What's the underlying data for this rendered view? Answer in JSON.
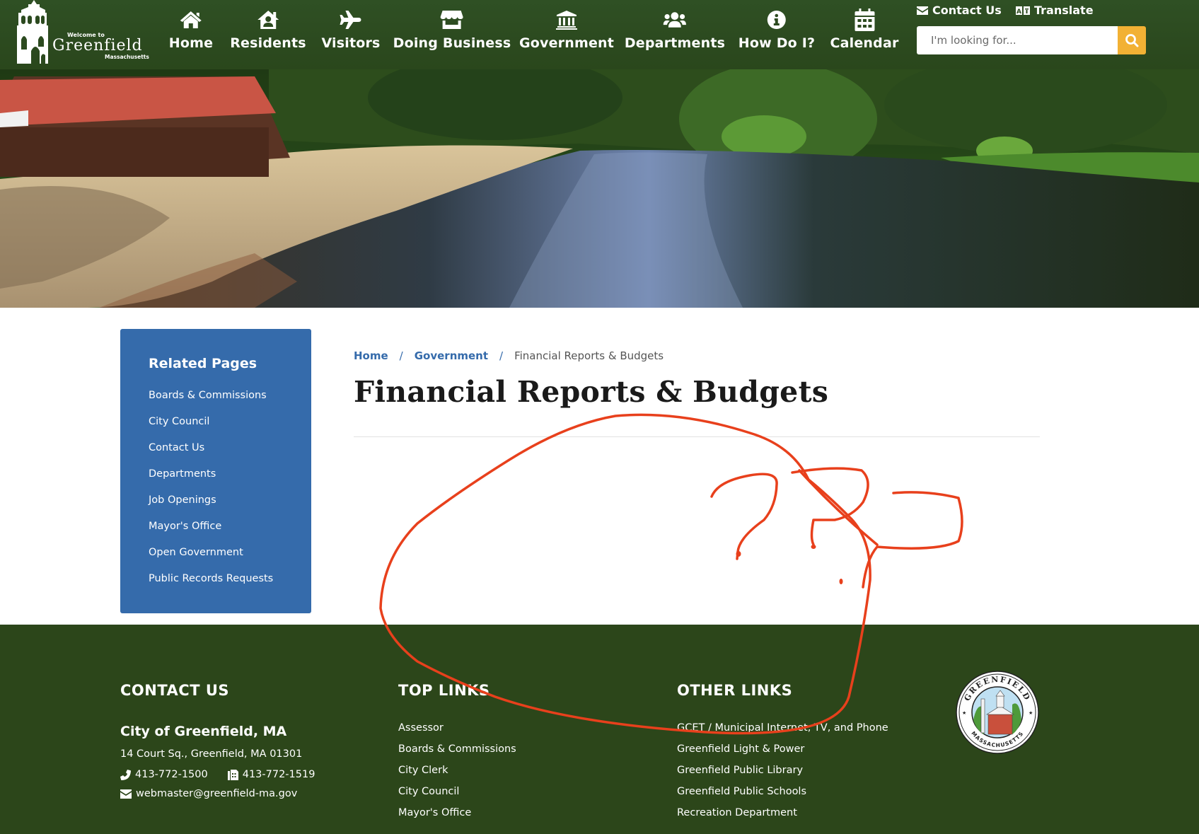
{
  "header": {
    "logo": {
      "welcome": "Welcome to",
      "name": "Greenfield",
      "state": "Massachusetts"
    },
    "nav": [
      {
        "label": "Home",
        "icon": "home-icon"
      },
      {
        "label": "Residents",
        "icon": "house-user-icon"
      },
      {
        "label": "Visitors",
        "icon": "plane-icon"
      },
      {
        "label": "Doing Business",
        "icon": "store-icon"
      },
      {
        "label": "Government",
        "icon": "landmark-icon"
      },
      {
        "label": "Departments",
        "icon": "users-icon"
      },
      {
        "label": "How Do I?",
        "icon": "info-circle-icon"
      },
      {
        "label": "Calendar",
        "icon": "calendar-icon"
      }
    ],
    "utility": {
      "contact_label": "Contact Us",
      "translate_label": "Translate"
    },
    "search": {
      "placeholder": "I'm looking for...",
      "value": ""
    },
    "colors": {
      "header_bg": "#2c4a1f",
      "search_button": "#f2b134"
    }
  },
  "sidebar": {
    "title": "Related Pages",
    "items": [
      "Boards & Commissions",
      "City Council",
      "Contact Us",
      "Departments",
      "Job Openings",
      "Mayor's Office",
      "Open Government",
      "Public Records Requests"
    ],
    "color": "#356bab"
  },
  "breadcrumb": {
    "items": [
      {
        "label": "Home",
        "link": true
      },
      {
        "label": "Government",
        "link": true
      },
      {
        "label": "Financial Reports & Budgets",
        "link": false
      }
    ],
    "separator": "/"
  },
  "main": {
    "title": "Financial Reports & Budgets"
  },
  "footer": {
    "contact": {
      "heading": "CONTACT US",
      "city": "City of Greenfield, MA",
      "address": "14 Court Sq., Greenfield, MA 01301",
      "phone": "413-772-1500",
      "fax": "413-772-1519",
      "email": "webmaster@greenfield-ma.gov"
    },
    "top_links": {
      "heading": "TOP LINKS",
      "items": [
        "Assessor",
        "Boards & Commissions",
        "City Clerk",
        "City Council",
        "Mayor's Office"
      ]
    },
    "other_links": {
      "heading": "OTHER LINKS",
      "items": [
        "GCET / Municipal Internet, TV, and Phone",
        "Greenfield Light & Power",
        "Greenfield Public Library",
        "Greenfield Public Schools",
        "Recreation Department"
      ]
    },
    "seal": {
      "top_text": "GREENFIELD",
      "bottom_text": "MASSACHUSETTS"
    },
    "color": "#2c461a"
  },
  "annotation": {
    "color": "#e8401c",
    "marks": "circle and question marks drawn over empty content area"
  }
}
